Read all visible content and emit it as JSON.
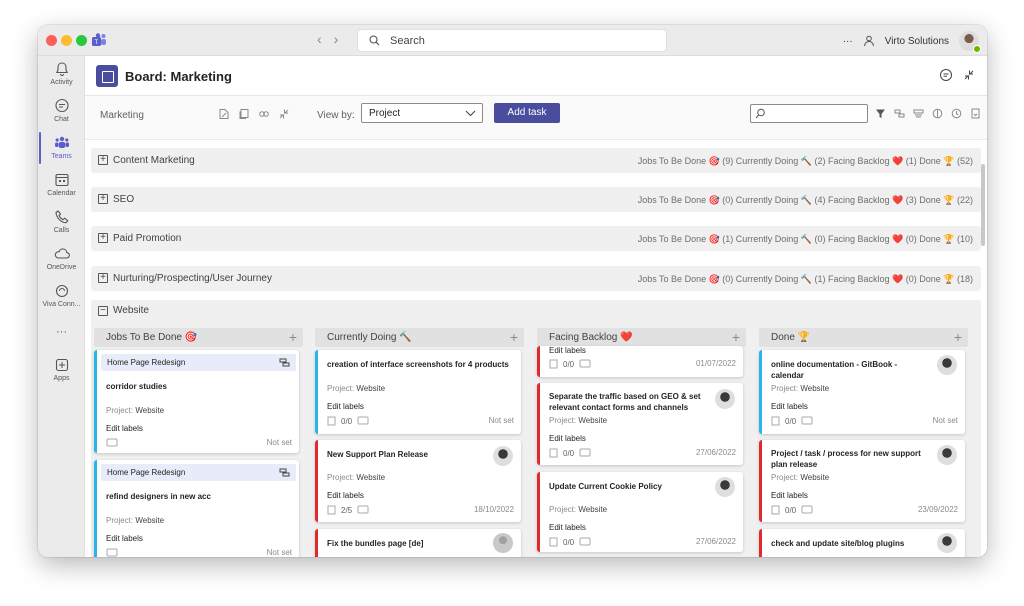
{
  "titlebar": {
    "search_placeholder": "Search",
    "more": "···",
    "account": "Virto Solutions"
  },
  "rail": [
    {
      "label": "Activity",
      "icon": "bell-icon"
    },
    {
      "label": "Chat",
      "icon": "chat-icon"
    },
    {
      "label": "Teams",
      "icon": "teams-icon"
    },
    {
      "label": "Calendar",
      "icon": "calendar-icon"
    },
    {
      "label": "Calls",
      "icon": "phone-icon"
    },
    {
      "label": "OneDrive",
      "icon": "cloud-icon"
    },
    {
      "label": "Viva Conn...",
      "icon": "viva-icon"
    },
    {
      "label": "···",
      "icon": "more-icon"
    },
    {
      "label": "Apps",
      "icon": "apps-icon"
    }
  ],
  "header": {
    "title": "Board: Marketing"
  },
  "toolbar": {
    "breadcrumb": "Marketing",
    "view_by_label": "View by:",
    "view_by_value": "Project",
    "add_task": "Add task"
  },
  "groups": [
    {
      "name": "Content Marketing",
      "stats": "Jobs To Be Done 🎯 (9) Currently Doing 🔨 (2) Facing Backlog ❤️ (1) Done 🏆 (52)"
    },
    {
      "name": "SEO",
      "stats": "Jobs To Be Done 🎯 (0) Currently Doing 🔨 (4) Facing Backlog ❤️ (3) Done 🏆 (22)"
    },
    {
      "name": "Paid Promotion",
      "stats": "Jobs To Be Done 🎯 (1) Currently Doing 🔨 (0) Facing Backlog ❤️ (0) Done 🏆 (10)"
    },
    {
      "name": "Nurturing/Prospecting/User Journey",
      "stats": "Jobs To Be Done 🎯 (0) Currently Doing 🔨 (1) Facing Backlog ❤️ (0) Done 🏆 (18)"
    }
  ],
  "website": {
    "name": "Website",
    "columns": [
      "Jobs To Be Done 🎯",
      "Currently Doing 🔨",
      "Facing Backlog ❤️",
      "Done 🏆"
    ]
  },
  "cards": {
    "todo": [
      {
        "tag": "Home Page Redesign",
        "title": "corridor studies",
        "project_label": "Project:",
        "project": "Website",
        "labels": "Edit labels",
        "date": "Not set"
      },
      {
        "tag": "Home Page Redesign",
        "title": "refind designers in new acc",
        "project_label": "Project:",
        "project": "Website",
        "labels": "Edit labels",
        "date": "Not set"
      }
    ],
    "doing": [
      {
        "title": "creation of interface screenshots for 4 products",
        "project_label": "Project:",
        "project": "Website",
        "labels": "Edit labels",
        "checklist": "0/0",
        "date": "Not set"
      },
      {
        "title": "New Support Plan Release",
        "project_label": "Project:",
        "project": "Website",
        "labels": "Edit labels",
        "checklist": "2/5",
        "date": "18/10/2022"
      },
      {
        "title": "Fix the bundles page [de]"
      }
    ],
    "backlog": [
      {
        "labels": "Edit labels",
        "checklist": "0/0",
        "date": "01/07/2022"
      },
      {
        "title": "Separate the traffic based on GEO & set relevant contact forms and channels",
        "project_label": "Project:",
        "project": "Website",
        "labels": "Edit labels",
        "checklist": "0/0",
        "date": "27/06/2022"
      },
      {
        "title": "Update Current Cookie Policy",
        "project_label": "Project:",
        "project": "Website",
        "labels": "Edit labels",
        "checklist": "0/0",
        "date": "27/06/2022"
      }
    ],
    "done": [
      {
        "title": "online documentation - GitBook - calendar",
        "project_label": "Project:",
        "project": "Website",
        "labels": "Edit labels",
        "checklist": "0/0",
        "date": "Not set"
      },
      {
        "title": "Project / task / process for new support plan release",
        "project_label": "Project:",
        "project": "Website",
        "labels": "Edit labels",
        "checklist": "0/0",
        "date": "23/09/2022"
      },
      {
        "title": "check and update site/blog plugins"
      }
    ]
  },
  "colors": {
    "accent": "#4a4d9e",
    "todo_border": "#29b5e8",
    "red_border": "#e02b2b"
  }
}
